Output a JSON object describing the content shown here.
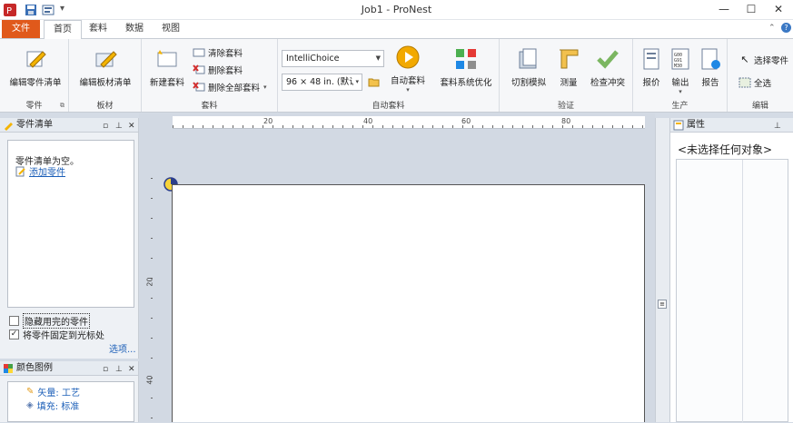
{
  "window": {
    "title": "Job1 - ProNest",
    "minimize_glyph": "—",
    "maximize_glyph": "☐",
    "close_glyph": "✕"
  },
  "tabs": {
    "file": "文件",
    "home": "首页",
    "nest": "套料",
    "data": "数据",
    "view": "视图"
  },
  "ribbon": {
    "parts": {
      "edit_parts_list": "编辑零件清单",
      "group": "零件"
    },
    "plates": {
      "edit_plate_list": "编辑板材清单",
      "group": "板材"
    },
    "nest": {
      "new_nest": "新建套料",
      "clear_nest": "清除套料",
      "delete_nest": "删除套料",
      "delete_all_nests": "删除全部套料",
      "group": "套料"
    },
    "auto": {
      "method": "IntelliChoice",
      "size": "96 × 48 in. (默认",
      "auto_nest": "自动套料",
      "optimizer": "套料系统优化",
      "group": "自动套料"
    },
    "verify": {
      "cut_sim": "切割模拟",
      "measure": "测量",
      "check_collision": "检查冲突",
      "group": "验证"
    },
    "production": {
      "quote": "报价",
      "output": "输出",
      "report": "报告",
      "group": "生产"
    },
    "edit": {
      "select_part": "选择零件",
      "select_all": "全选",
      "group": "编辑"
    }
  },
  "parts_pane": {
    "title": "零件清单",
    "empty_text": "零件清单为空。",
    "add_part": "添加零件",
    "hide_used": "隐藏用完的零件",
    "pin_to_cursor": "将零件固定到光标处",
    "pin_checked": true,
    "options": "选项..."
  },
  "legend_pane": {
    "title": "颜色图例",
    "vector": "矢量: 工艺",
    "fill": "填充: 标准"
  },
  "ruler": {
    "top_labels": [
      "20",
      "40",
      "60",
      "80"
    ],
    "left_labels": [
      "20",
      "40"
    ]
  },
  "props_pane": {
    "title": "属性",
    "no_selection": "<未选择任何对象>"
  },
  "colors": {
    "file_tab": "#e0591b",
    "accent_blue": "#1c5fb8"
  }
}
